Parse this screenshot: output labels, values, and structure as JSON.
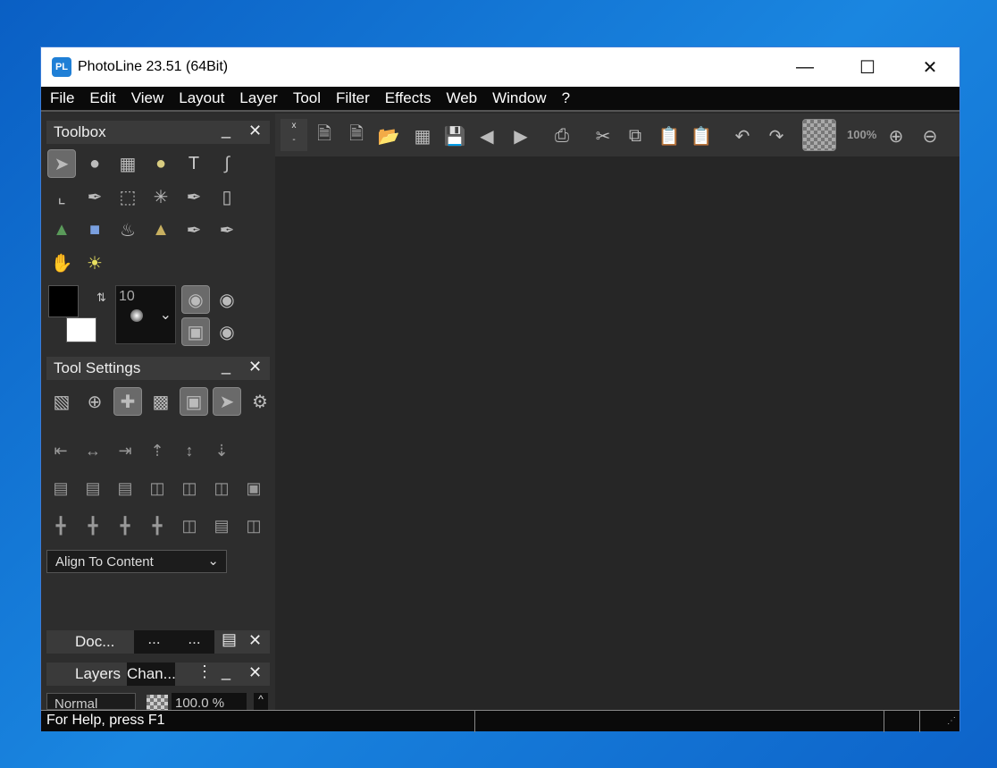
{
  "window": {
    "title": "PhotoLine 23.51 (64Bit)",
    "logo": "PL",
    "controls": [
      "minimize",
      "maximize",
      "close"
    ]
  },
  "menu": [
    "File",
    "Edit",
    "View",
    "Layout",
    "Layer",
    "Tool",
    "Filter",
    "Effects",
    "Web",
    "Window",
    "?"
  ],
  "toolbox": {
    "title": "Toolbox",
    "tools": [
      "pointer",
      "ellipse-shape",
      "mesh-brush",
      "circle-shape",
      "text",
      "path",
      "crop",
      "eyedropper",
      "rect-select",
      "magic-wand",
      "brush",
      "eraser",
      "spray",
      "gradient",
      "fill",
      "stamp",
      "clone-brush",
      "patch-brush",
      "smudge-hand",
      "dodge"
    ],
    "brush_size": "10"
  },
  "tool_settings": {
    "title": "Tool Settings",
    "align_dropdown": "Align To Content"
  },
  "docs_panel": {
    "title": "Doc...",
    "tabs": [
      "...",
      "..."
    ]
  },
  "layers_panel": {
    "title": "Layers",
    "tab2": "Chan...",
    "blend_mode": "Normal",
    "opacity": "100.0 %"
  },
  "toolbar": {
    "zoom": "100%"
  },
  "status": {
    "text": "For Help, press F1"
  }
}
